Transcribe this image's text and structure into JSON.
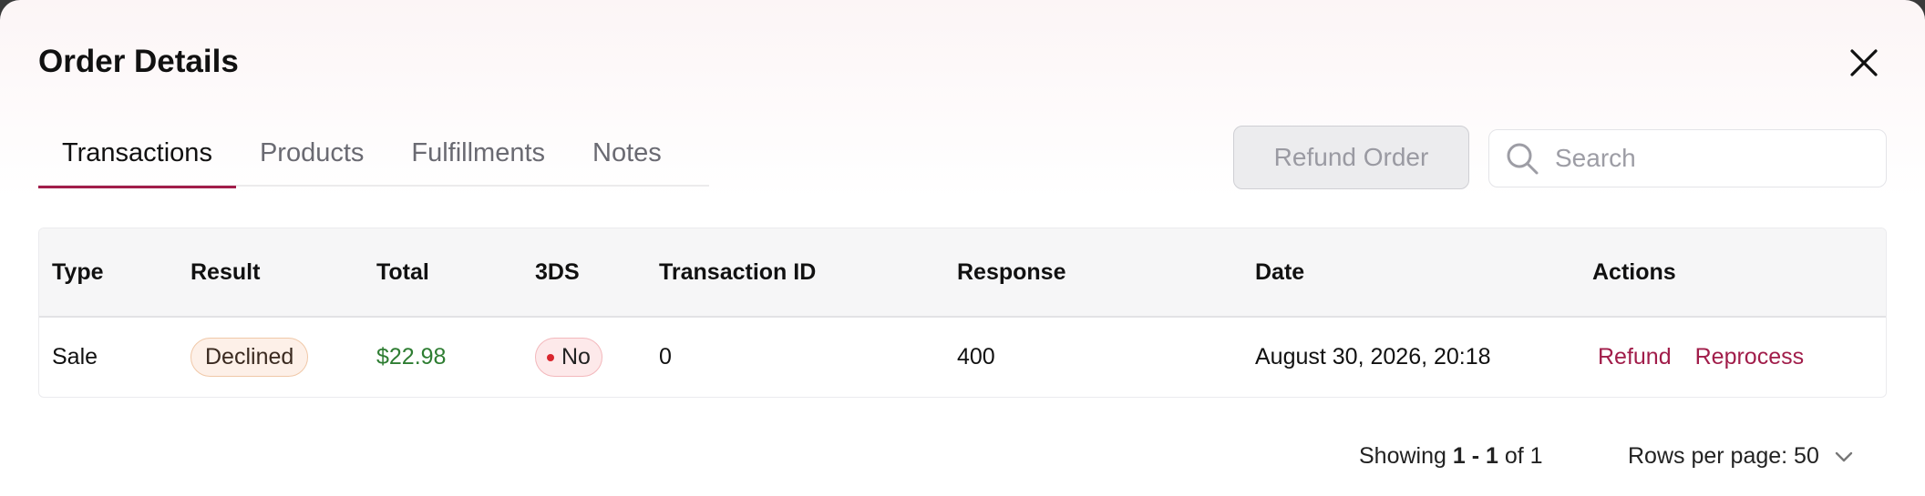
{
  "modal": {
    "title": "Order Details"
  },
  "tabs": [
    {
      "label": "Transactions",
      "active": true
    },
    {
      "label": "Products",
      "active": false
    },
    {
      "label": "Fulfillments",
      "active": false
    },
    {
      "label": "Notes",
      "active": false
    }
  ],
  "toolbar": {
    "refund_order_label": "Refund Order",
    "search_placeholder": "Search",
    "search_value": ""
  },
  "table": {
    "columns": [
      "Type",
      "Result",
      "Total",
      "3DS",
      "Transaction ID",
      "Response",
      "Date",
      "Actions"
    ],
    "rows": [
      {
        "type": "Sale",
        "result": "Declined",
        "total": "$22.98",
        "three_ds": "No",
        "transaction_id": "0",
        "response": "400",
        "date": "August 30, 2026, 20:18",
        "actions": [
          "Refund",
          "Reprocess"
        ]
      }
    ]
  },
  "pagination": {
    "showing_prefix": "Showing",
    "range": "1 - 1",
    "of_text": "of 1",
    "rows_per_page_label": "Rows per page: 50"
  },
  "icons": {
    "close": "close-icon",
    "search": "search-icon",
    "rows_dropdown": "chevron-down-icon"
  },
  "colors": {
    "accent": "#a11d4a",
    "total_green": "#2e7d32",
    "status_red": "#d9262e",
    "declined_bg": "#fdf0e8"
  }
}
